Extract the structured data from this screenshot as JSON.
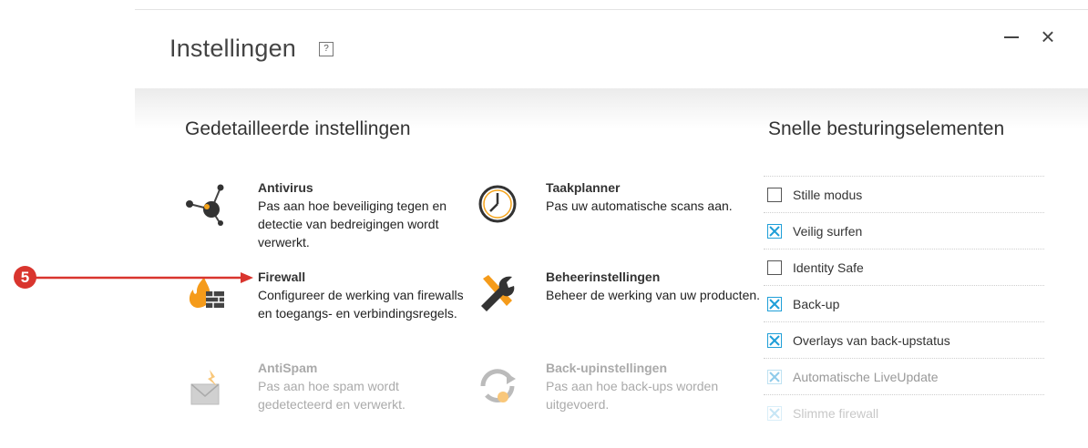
{
  "window": {
    "title": "Instellingen",
    "help_label": "?",
    "close_label": "×"
  },
  "detailed": {
    "heading": "Gedetailleerde instellingen",
    "items": [
      {
        "name": "Antivirus",
        "desc": "Pas aan hoe beveiliging tegen en detectie van bedreigingen wordt verwerkt.",
        "icon": "antivirus-icon"
      },
      {
        "name": "Taakplanner",
        "desc": "Pas uw automatische scans aan.",
        "icon": "clock-icon"
      },
      {
        "name": "Firewall",
        "desc": "Configureer de werking van firewalls en toegangs- en verbindingsregels.",
        "icon": "firewall-icon"
      },
      {
        "name": "Beheerinstellingen",
        "desc": "Beheer de werking van uw producten.",
        "icon": "tools-icon"
      },
      {
        "name": "AntiSpam",
        "desc": "Pas aan hoe spam wordt gedetecteerd en verwerkt.",
        "icon": "antispam-icon"
      },
      {
        "name": "Back-upinstellingen",
        "desc": "Pas aan hoe back-ups worden uitgevoerd.",
        "icon": "backup-icon"
      }
    ]
  },
  "quick": {
    "heading": "Snelle besturingselementen",
    "items": [
      {
        "label": "Stille modus",
        "checked": false
      },
      {
        "label": "Veilig surfen",
        "checked": true
      },
      {
        "label": "Identity Safe",
        "checked": false
      },
      {
        "label": "Back-up",
        "checked": true
      },
      {
        "label": "Overlays van back-upstatus",
        "checked": true
      },
      {
        "label": "Automatische LiveUpdate",
        "checked": true
      },
      {
        "label": "Slimme firewall",
        "checked": true
      }
    ]
  },
  "annotation": {
    "marker_number": "5",
    "color": "#d9352e"
  },
  "colors": {
    "check_accent": "#1f9fd8",
    "firewall_flame": "#f59b1a"
  }
}
